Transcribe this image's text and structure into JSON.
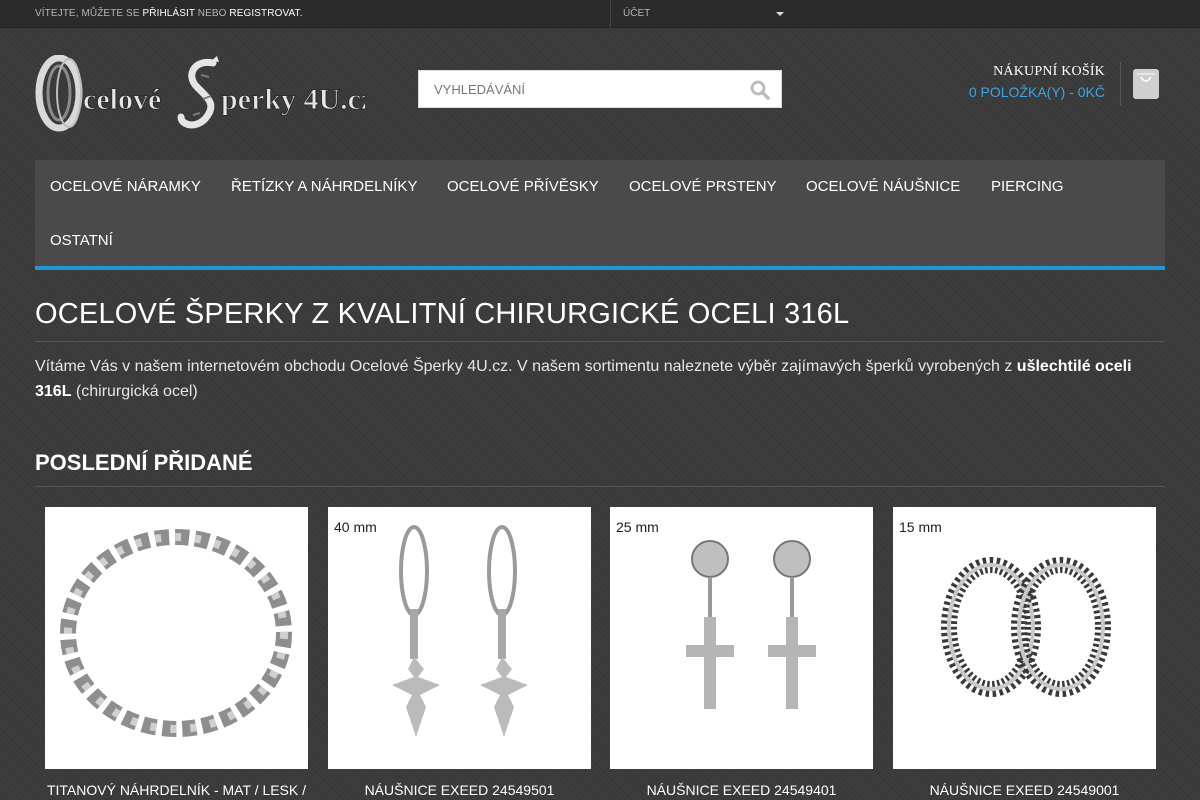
{
  "topbar": {
    "welcome_prefix": "Vítejte, můžete se",
    "login": "přihlásit",
    "or": "nebo",
    "register": "registrovat.",
    "account": "Účet"
  },
  "header": {
    "logo_text": "Ocelové Šperky 4U.cz",
    "search_placeholder": "VYHLEDÁVÁNÍ",
    "cart_title": "NÁKUPNÍ KOŠÍK",
    "cart_summary": "0 POLOŽKA(Y) - 0KČ"
  },
  "icons": {
    "search": "search-icon",
    "cart": "shopping-bag-icon",
    "account_caret": "caret-down-icon"
  },
  "colors": {
    "accent": "#2196d3",
    "cart_summary": "#3aa6e0"
  },
  "nav": {
    "items": [
      "Ocelové náramky",
      "Řetízky a náhrdelníky",
      "Ocelové přívěsky",
      "Ocelové prsteny",
      "Ocelové náušnice",
      "Piercing",
      "Ostatní"
    ]
  },
  "main": {
    "title": "OCELOVÉ ŠPERKY Z KVALITNÍ CHIRURGICKÉ OCELI 316L",
    "intro_text": "Vítáme Vás v našem internetovém obchodu Ocelové Šperky 4U.cz. V našem sortimentu naleznete výběr zajímavých šperků vyrobených z",
    "intro_bold": "ušlechtilé oceli 316L",
    "intro_tail": "(chirurgická ocel)",
    "section_title": "POSLEDNÍ PŘIDANÉ"
  },
  "products": [
    {
      "name": "TITANOVÝ NÁHRDELNÍK - MAT / LESK /",
      "size": ""
    },
    {
      "name": "NÁUŠNICE EXEED 24549501",
      "size": "40 mm"
    },
    {
      "name": "NÁUŠNICE EXEED 24549401",
      "size": "25 mm"
    },
    {
      "name": "NÁUŠNICE EXEED 24549001",
      "size": "15 mm"
    }
  ]
}
